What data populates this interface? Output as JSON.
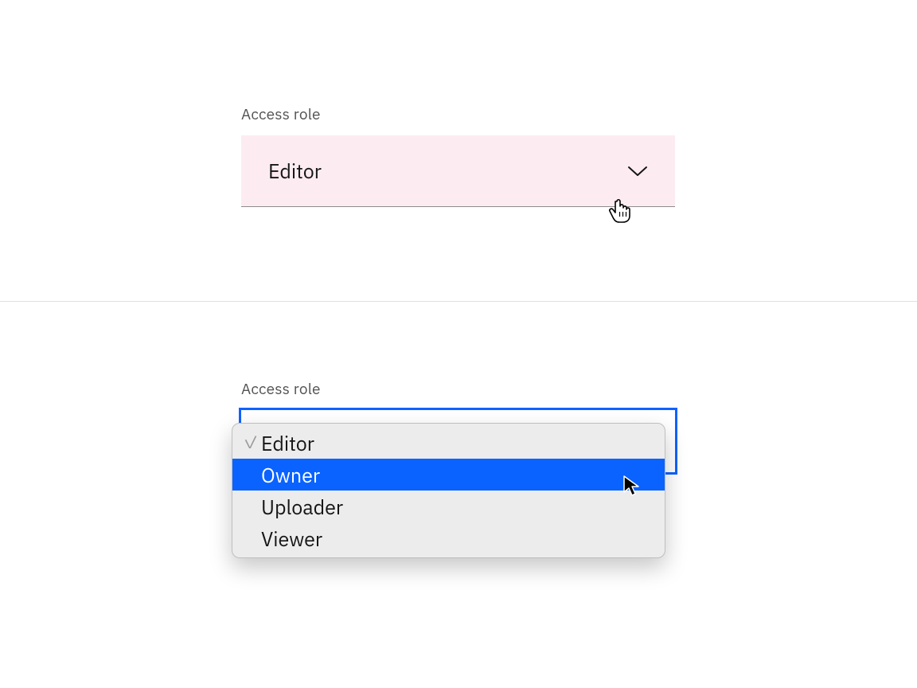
{
  "colors": {
    "hover_bg": "#fcecf1",
    "focus_ring": "#0f62fe",
    "menu_highlight": "#0a63ff",
    "text": "#161616",
    "label": "#525252"
  },
  "top": {
    "label": "Access role",
    "selected": "Editor"
  },
  "bottom": {
    "label": "Access role",
    "selected": "Editor",
    "highlighted": "Owner",
    "options": [
      "Editor",
      "Owner",
      "Uploader",
      "Viewer"
    ]
  }
}
